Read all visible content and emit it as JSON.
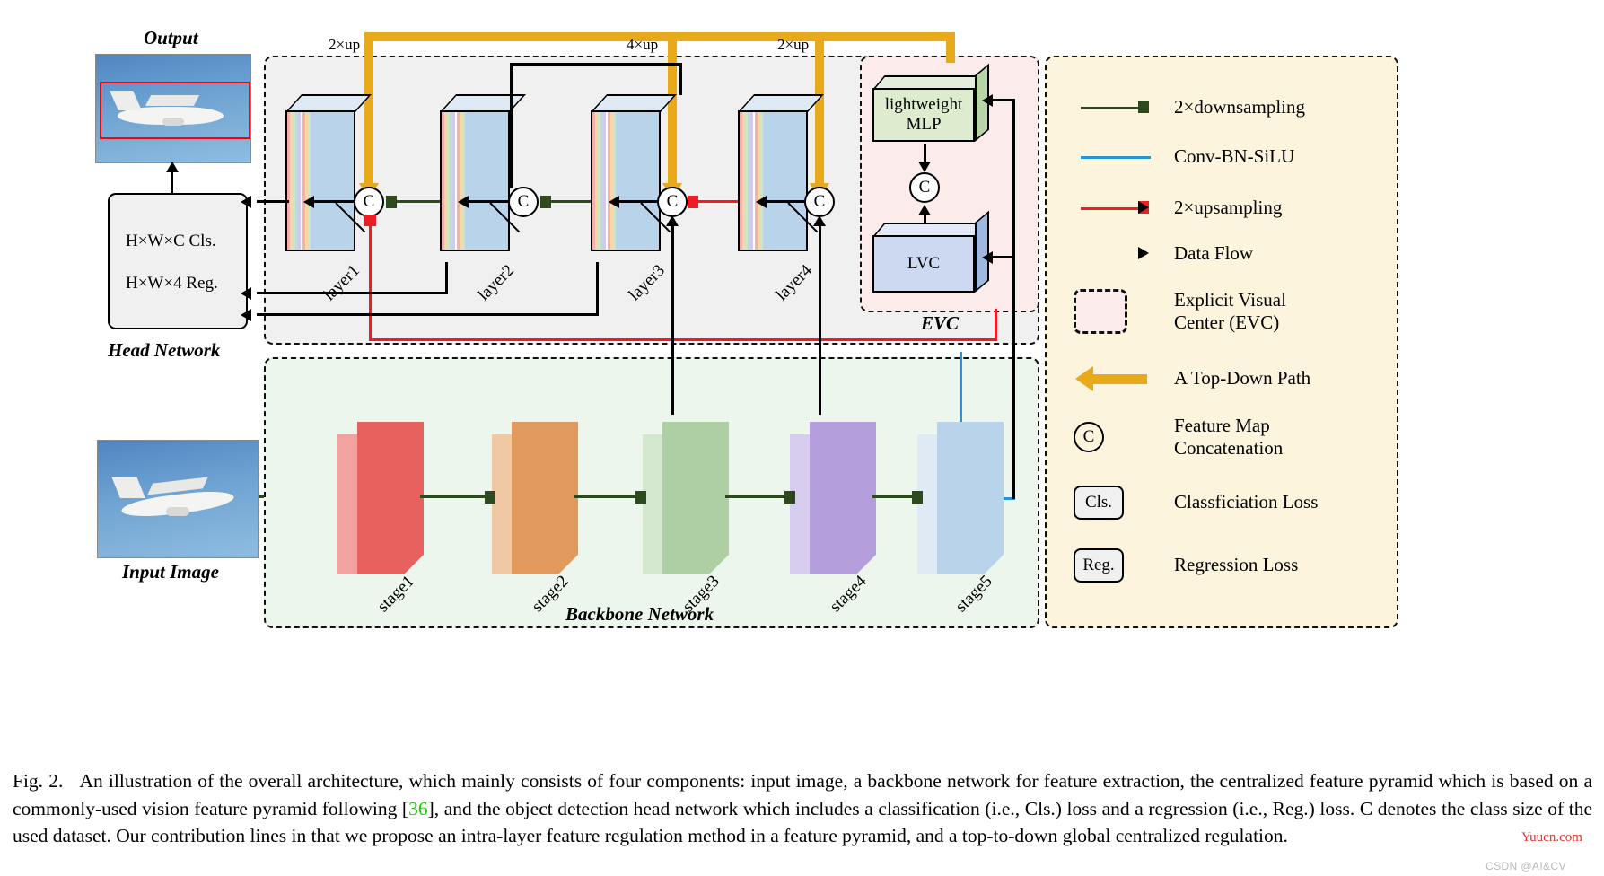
{
  "figure": {
    "caption_prefix": "Fig. 2.",
    "caption_part1": "An illustration of the overall architecture, which mainly consists of four components: input image, a backbone network for feature extraction, the centralized feature pyramid which is based on a commonly-used vision feature pyramid following [",
    "citation": "36",
    "caption_part2": "], and the object detection head network which includes a classification (i.e., Cls.) loss and a regression (i.e., Reg.) loss. C denotes the class size of the used dataset. Our contribution lines in that we propose an intra-layer feature regulation method in a feature pyramid, and a top-to-down global centralized regulation.",
    "watermark_primary": "Yuucn.com",
    "watermark_secondary": "CSDN @AI&CV"
  },
  "output": {
    "title": "Output"
  },
  "input": {
    "title": "Input Image"
  },
  "head": {
    "title": "Head Network",
    "cls_line": "H×W×C  Cls.",
    "reg_line": "H×W×4  Reg."
  },
  "topdown": {
    "label_left": "2×up",
    "label_mid": "4×up",
    "label_right": "2×up"
  },
  "fpn": {
    "layers": [
      {
        "label": "layer1"
      },
      {
        "label": "layer2"
      },
      {
        "label": "layer3"
      },
      {
        "label": "layer4"
      }
    ],
    "concat_symbol": "C"
  },
  "evc": {
    "title": "EVC",
    "mlp_label": "lightweight\nMLP",
    "lvc_label": "LVC",
    "concat_symbol": "C"
  },
  "backbone": {
    "title": "Backbone Network",
    "stages": [
      {
        "label": "stage1",
        "color": "#e8615e",
        "side": "#f2a3a0"
      },
      {
        "label": "stage2",
        "color": "#e09a5e",
        "side": "#f0c9a4"
      },
      {
        "label": "stage3",
        "color": "#aecfa3",
        "side": "#d3e6ce"
      },
      {
        "label": "stage4",
        "color": "#b49fdc",
        "side": "#d7cdee"
      },
      {
        "label": "stage5",
        "color": "#b9d3ea",
        "side": "#dfeaf5"
      }
    ]
  },
  "legend": {
    "items": [
      {
        "key": "green-arrow-icon",
        "label": "2×downsampling",
        "color": "#2d4a1e"
      },
      {
        "key": "blue-line-icon",
        "label": "Conv-BN-SiLU",
        "color": "#2196dd"
      },
      {
        "key": "red-arrow-icon",
        "label": "2×upsampling",
        "color": "#ee1c25"
      },
      {
        "key": "black-arrow-icon",
        "label": "Data Flow",
        "color": "#000000"
      },
      {
        "key": "dashed-box-icon",
        "label": "Explicit Visual\nCenter (EVC)",
        "color": "#fbeceb"
      },
      {
        "key": "gold-arrow-icon",
        "label": "A Top-Down Path",
        "color": "#e8a91b"
      },
      {
        "key": "concat-circle-icon",
        "label": "Feature Map\nConcatenation",
        "color": "#000000",
        "symbol": "C"
      },
      {
        "key": "cls-tag-icon",
        "label": "Classficiation Loss",
        "color": "#000000",
        "symbol": "Cls."
      },
      {
        "key": "reg-tag-icon",
        "label": "Regression Loss",
        "color": "#000000",
        "symbol": "Reg."
      }
    ]
  },
  "colors": {
    "gold": "#e8a91b",
    "red": "#ee1c25",
    "green": "#2d4a1e",
    "blue": "#2196dd",
    "fpn_bg": "#f0f0f0",
    "evc_bg": "#fbeceb",
    "backbone_bg": "#edf6ec",
    "legend_bg": "#fdf4dd"
  }
}
